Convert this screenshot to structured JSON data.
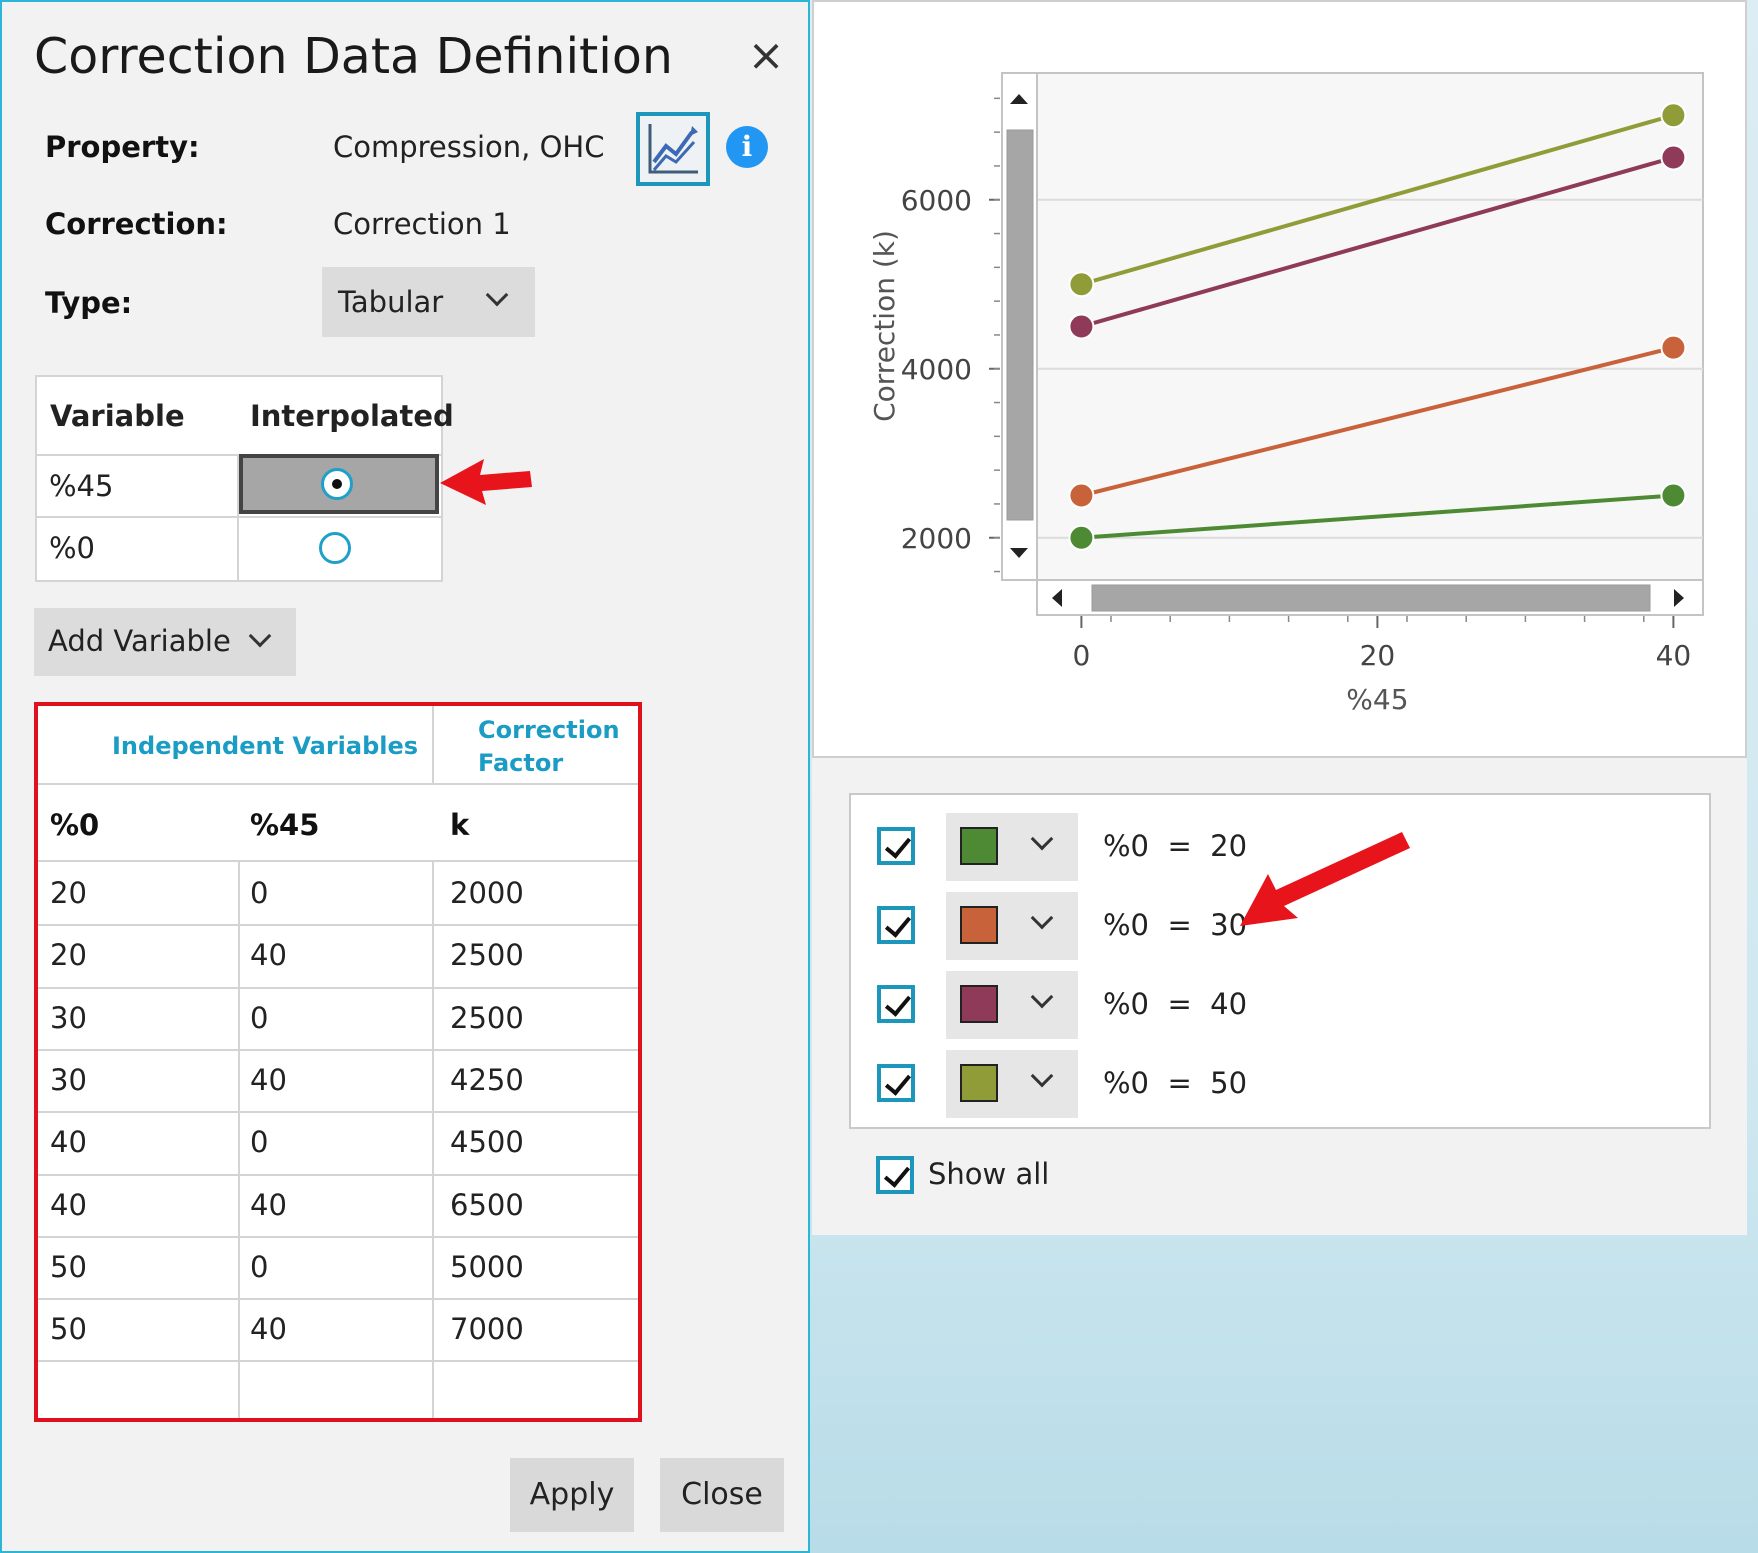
{
  "dialog": {
    "title": "Correction Data Definition",
    "close_icon": "×",
    "property_label": "Property:",
    "property_value": "Compression, OHC",
    "correction_label": "Correction:",
    "correction_value": "Correction 1",
    "type_label": "Type:",
    "type_value": "Tabular",
    "info_icon": "i"
  },
  "variables_table": {
    "headers": [
      "Variable",
      "Interpolated"
    ],
    "rows": [
      {
        "variable": "%45",
        "interpolated": true
      },
      {
        "variable": "%0",
        "interpolated": false
      }
    ]
  },
  "add_variable_label": "Add Variable",
  "data_table": {
    "group_headers": [
      "Independent Variables",
      "Correction",
      "Factor"
    ],
    "columns": [
      "%0",
      "%45",
      "k"
    ],
    "rows": [
      [
        "20",
        "0",
        "2000"
      ],
      [
        "20",
        "40",
        "2500"
      ],
      [
        "30",
        "0",
        "2500"
      ],
      [
        "30",
        "40",
        "4250"
      ],
      [
        "40",
        "0",
        "4500"
      ],
      [
        "40",
        "40",
        "6500"
      ],
      [
        "50",
        "0",
        "5000"
      ],
      [
        "50",
        "40",
        "7000"
      ]
    ]
  },
  "buttons": {
    "apply": "Apply",
    "close": "Close"
  },
  "chart_data": {
    "type": "line",
    "xlabel": "%45",
    "ylabel": "Correction (k)",
    "x_ticks": [
      "0",
      "20",
      "40"
    ],
    "y_ticks": [
      "2000",
      "4000",
      "6000"
    ],
    "xlim": [
      -3,
      42
    ],
    "ylim": [
      1500,
      7500
    ],
    "grid": true,
    "series": [
      {
        "name": "%0 = 20",
        "color": "#4e8a34",
        "x": [
          0,
          40
        ],
        "y": [
          2000,
          2500
        ]
      },
      {
        "name": "%0 = 30",
        "color": "#c8623a",
        "x": [
          0,
          40
        ],
        "y": [
          2500,
          4250
        ]
      },
      {
        "name": "%0 = 40",
        "color": "#8e3a58",
        "x": [
          0,
          40
        ],
        "y": [
          4500,
          6500
        ]
      },
      {
        "name": "%0 = 50",
        "color": "#8f9c38",
        "x": [
          0,
          40
        ],
        "y": [
          5000,
          7000
        ]
      }
    ]
  },
  "legend": {
    "items": [
      {
        "label": "%0  =  20",
        "color": "#4e8a34",
        "checked": true
      },
      {
        "label": "%0  =  30",
        "color": "#c8623a",
        "checked": true
      },
      {
        "label": "%0  =  40",
        "color": "#8e3a58",
        "checked": true
      },
      {
        "label": "%0  =  50",
        "color": "#8f9c38",
        "checked": true
      }
    ],
    "show_all_label": "Show all"
  },
  "colors": {
    "accent": "#1c97bb",
    "highlight_red": "#e0101e",
    "arrow_red": "#e8141c"
  }
}
